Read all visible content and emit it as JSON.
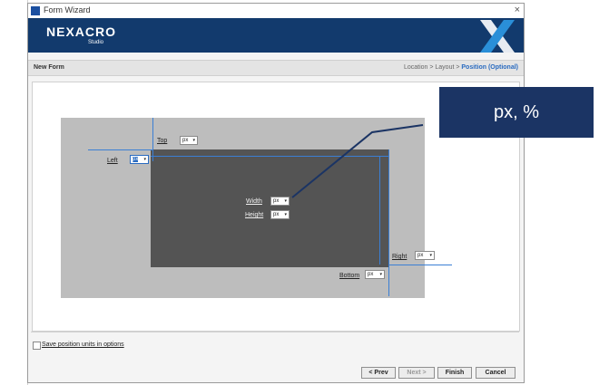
{
  "window": {
    "title": "Form Wizard",
    "close_glyph": "×"
  },
  "banner": {
    "brand": "NEXACRO",
    "sub": "Studio"
  },
  "header": {
    "form_title": "New Form",
    "crumb_base": "Location > Layout > ",
    "crumb_active": "Position (Optional)"
  },
  "labels": {
    "top": "Top",
    "left": "Left",
    "width": "Width",
    "height": "Height",
    "right": "Right",
    "bottom": "Bottom"
  },
  "selects": {
    "top": "px",
    "left": "px",
    "width": "px",
    "height": "px",
    "right": "px",
    "bottom": "px"
  },
  "caret": "▾",
  "checkbox": {
    "label": "Save position units in options",
    "checked": false
  },
  "buttons": {
    "prev": "< Prev",
    "next": "Next >",
    "finish": "Finish",
    "cancel": "Cancel"
  },
  "callout": {
    "text": "px, %"
  },
  "colors": {
    "accent": "#2a6bc0",
    "guide_line": "#3b7fd4",
    "banner": "#123a6d",
    "callout_bg": "#1b3464"
  }
}
